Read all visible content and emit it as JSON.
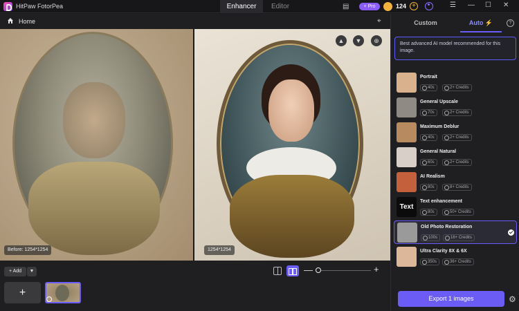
{
  "app": {
    "title": "HitPaw FotorPea"
  },
  "tabs": [
    {
      "label": "Enhancer"
    },
    {
      "label": "Editor"
    }
  ],
  "titlebar": {
    "pro_label": "+ Pro",
    "credits": "124"
  },
  "topbar": {
    "home_label": "Home"
  },
  "canvas": {
    "before_label": "Before: 1254*1254",
    "after_label": "1254*1254"
  },
  "bottom": {
    "add_label": "Add"
  },
  "right": {
    "tabs": [
      {
        "label": "Custom"
      },
      {
        "label": "Auto"
      }
    ],
    "tip": "Best advanced AI model recommended for this image.",
    "models": [
      {
        "name": "Portrait",
        "time": "40s",
        "credits": "2+ Credits",
        "color": "#d9b18c"
      },
      {
        "name": "General Upscale",
        "time": "70s",
        "credits": "2+ Credits",
        "color": "#8f8a84"
      },
      {
        "name": "Maximum Deblur",
        "time": "40s",
        "credits": "2+ Credits",
        "color": "#b88a60"
      },
      {
        "name": "General Natural",
        "time": "60s",
        "credits": "2+ Credits",
        "color": "#d8d0c8"
      },
      {
        "name": "AI Realism",
        "time": "80s",
        "credits": "8+ Credits",
        "color": "#c4603c"
      },
      {
        "name": "Text enhancement",
        "time": "80s",
        "credits": "50+ Credits",
        "color": "#0b0b0b",
        "thumb_text": "Text"
      },
      {
        "name": "Old Photo Restoration",
        "time": "100s",
        "credits": "16+ Credits",
        "color": "#9a9a9a",
        "selected": true
      },
      {
        "name": "Ultra Clarity 8X & 6X",
        "time": "350s",
        "credits": "36+ Credits",
        "color": "#dcb79a"
      }
    ],
    "export_label": "Export 1 images"
  }
}
